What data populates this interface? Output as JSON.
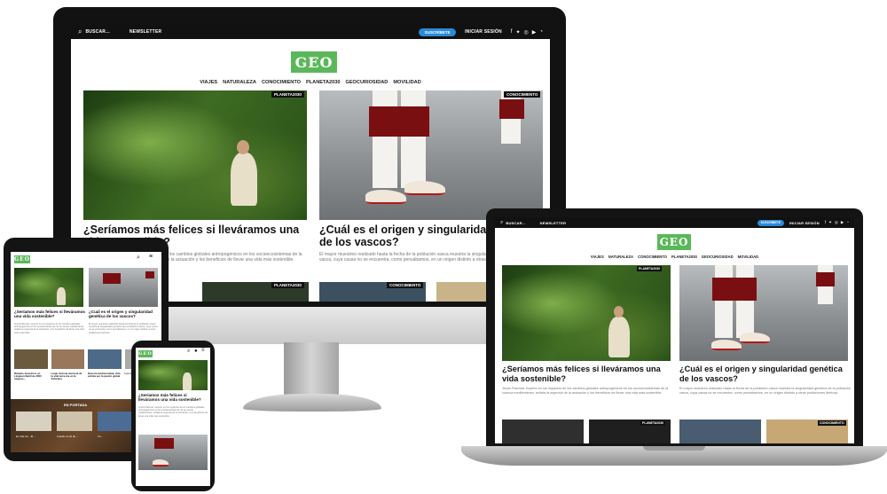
{
  "site": {
    "search_label": "BUSCAR...",
    "newsletter_label": "NEWSLETTER",
    "subscribe_label": "SUSCRÍBETE",
    "login_label": "INICIAR SESIÓN",
    "logo_text": "GEO",
    "social_icons": [
      "facebook-icon",
      "twitter-icon",
      "instagram-icon",
      "youtube-icon",
      "rss-icon"
    ],
    "nav_items": [
      "VIAJES",
      "NATURALEZA",
      "CONOCIMIENTO",
      "PLANETA2030",
      "GEOCURIOSIDAD",
      "MOVILIDAD"
    ]
  },
  "articles": [
    {
      "tag": "PLANETA2030",
      "title": "¿Seríamos más felices si lleváramos una vida sostenible?",
      "lede": "Jesús Palomar, experto en los impactos de los cambios globales antropogénicos en los socioecosistemas de la cuenca mediterránea, señala la urgencia de la actuación y los beneficios de llevar una vida más sostenible."
    },
    {
      "tag": "CONOCIMIENTO",
      "title": "¿Cuál es el origen y singularidad genética de los vascos?",
      "lede": "El mayor muestreo realizado hasta la fecha de la población vasca muestra la singularidad genética de la población vasca, cuya causa no se encuentra, como pensábamos, en un origen distinto a otras poblaciones ibéricas."
    }
  ],
  "row2_tags": [
    "NATURALEZA",
    "PLANETA2030",
    "CONOCIMIENTO"
  ],
  "tablet": {
    "grid_captions": [
      "Rituales funerarios en Lingwa infantil de 3000 mujeres...",
      "Largo historia mariscal de la vida terrestre en la Antártica",
      "Nuestra biodiversidad, vida extinta por la pasión global",
      "Los más grandes..."
    ],
    "section_label": "EN PORTADA",
    "bottom_captions": [
      "Es más vio... El ...",
      "Cuando el sol de ...",
      "Un..."
    ]
  },
  "colors": {
    "accent_blue": "#2b8ad8",
    "logo_green": "#5bb85a",
    "bar_black": "#111111"
  }
}
